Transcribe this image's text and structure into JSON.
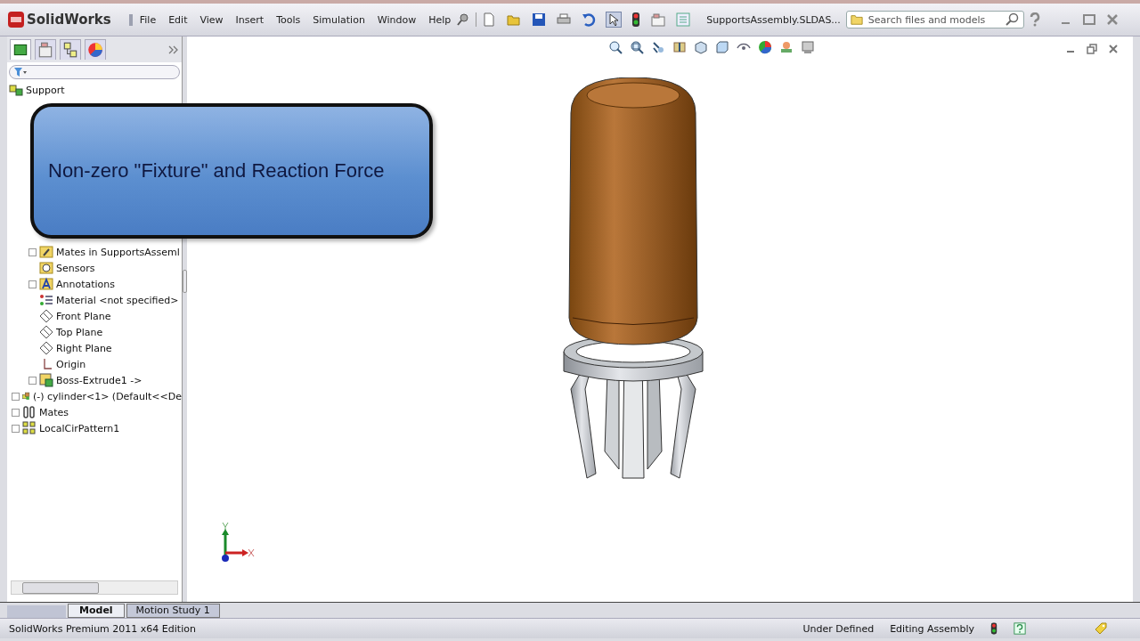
{
  "app": {
    "logo": "SolidWorks",
    "menu": [
      "File",
      "Edit",
      "View",
      "Insert",
      "Tools",
      "Simulation",
      "Window",
      "Help"
    ],
    "document": "SupportsAssembly.SLDAS...",
    "search": {
      "placeholder": "Search files and models"
    }
  },
  "tree": {
    "root": "Support",
    "branch": [
      {
        "label": "Mates in SupportsAsseml",
        "kind": "matesfolder",
        "expandable": true
      },
      {
        "label": "Sensors",
        "kind": "sensor",
        "expandable": false
      },
      {
        "label": "Annotations",
        "kind": "annotation",
        "expandable": true
      },
      {
        "label": "Material <not specified>",
        "kind": "material",
        "expandable": false
      },
      {
        "label": "Front Plane",
        "kind": "plane",
        "expandable": false
      },
      {
        "label": "Top Plane",
        "kind": "plane",
        "expandable": false
      },
      {
        "label": "Right Plane",
        "kind": "plane",
        "expandable": false
      },
      {
        "label": "Origin",
        "kind": "origin",
        "expandable": false
      },
      {
        "label": "Boss-Extrude1 ->",
        "kind": "feature",
        "expandable": true
      }
    ],
    "items": [
      {
        "label": "(-) cylinder<1> (Default<<De",
        "kind": "part",
        "expandable": true
      },
      {
        "label": "Mates",
        "kind": "mates",
        "expandable": true
      },
      {
        "label": "LocalCirPattern1",
        "kind": "pattern",
        "expandable": true
      }
    ]
  },
  "callout": "Non-zero \"Fixture\" and Reaction Force",
  "bottom_tabs": [
    {
      "label": "Model",
      "selected": true
    },
    {
      "label": "Motion Study 1",
      "selected": false
    }
  ],
  "status_bar": {
    "edition": "SolidWorks Premium 2011 x64 Edition",
    "definition": "Under Defined",
    "mode": "Editing Assembly"
  }
}
